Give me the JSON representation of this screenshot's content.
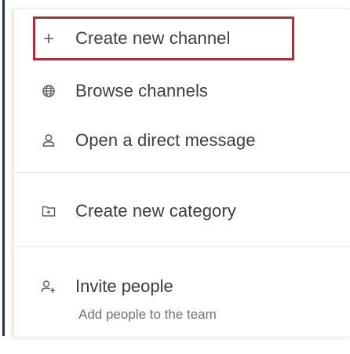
{
  "menu": {
    "items": [
      {
        "label": "Create new channel",
        "icon": "plus-icon"
      },
      {
        "label": "Browse channels",
        "icon": "globe-icon"
      },
      {
        "label": "Open a direct message",
        "icon": "person-icon"
      },
      {
        "label": "Create new category",
        "icon": "folder-plus-icon"
      }
    ],
    "invite": {
      "label": "Invite people",
      "sublabel": "Add people to the team",
      "icon": "invite-people-icon"
    }
  },
  "colors": {
    "highlight": "#a4343a",
    "text": "#3d3c40",
    "subtext": "#707070",
    "sidebar_edge": "#1e325c"
  }
}
